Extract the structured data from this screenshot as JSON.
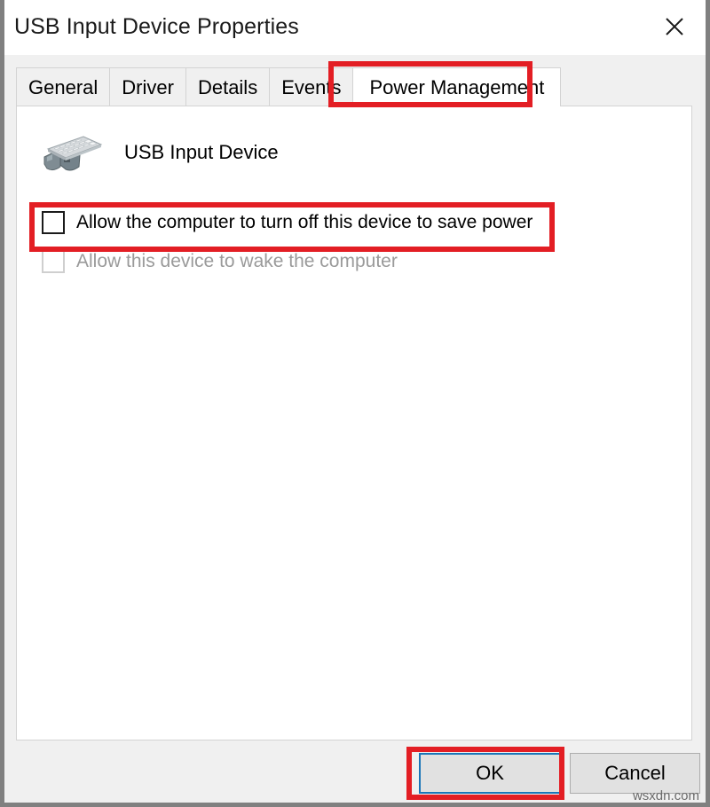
{
  "window": {
    "title": "USB Input Device Properties",
    "close_icon": "close-icon"
  },
  "tabs": [
    {
      "label": "General",
      "selected": false
    },
    {
      "label": "Driver",
      "selected": false
    },
    {
      "label": "Details",
      "selected": false
    },
    {
      "label": "Events",
      "selected": false
    },
    {
      "label": "Power Management",
      "selected": true
    }
  ],
  "content": {
    "device_icon": "usb-input-device-icon",
    "device_name": "USB Input Device",
    "checkboxes": [
      {
        "label": "Allow the computer to turn off this device to save power",
        "checked": false,
        "disabled": false
      },
      {
        "label": "Allow this device to wake the computer",
        "checked": false,
        "disabled": true
      }
    ]
  },
  "footer": {
    "ok_label": "OK",
    "cancel_label": "Cancel"
  },
  "annotations": {
    "color": "#e31e24",
    "targets": [
      "power-management-tab",
      "turn-off-device-checkbox",
      "ok-button"
    ]
  },
  "watermark": "wsxdn.com"
}
